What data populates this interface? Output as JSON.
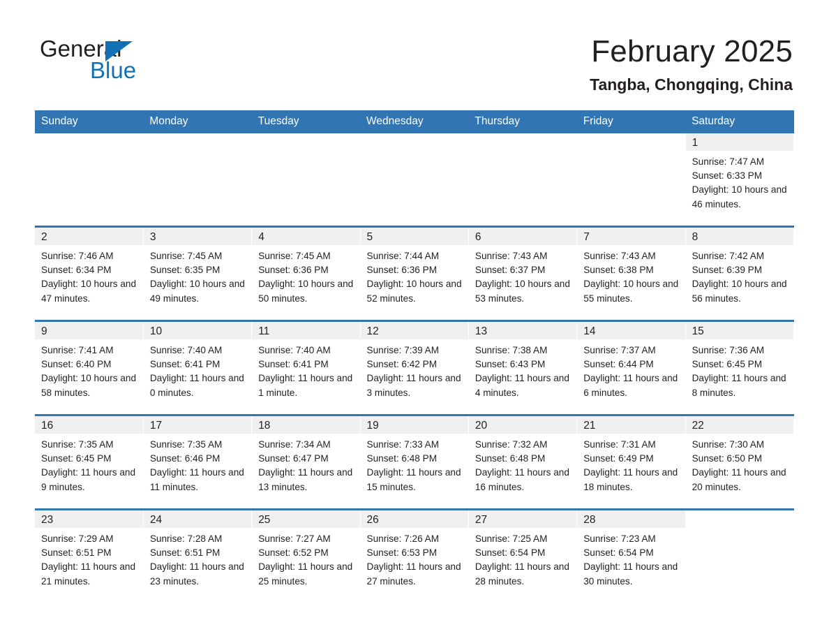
{
  "brand": {
    "name_part1": "General",
    "name_part2": "Blue",
    "accent_color": "#1271b5"
  },
  "header": {
    "title": "February 2025",
    "location": "Tangba, Chongqing, China"
  },
  "calendar": {
    "header_bg": "#3275b3",
    "daynum_bg": "#f0f0f0",
    "weekdays": [
      "Sunday",
      "Monday",
      "Tuesday",
      "Wednesday",
      "Thursday",
      "Friday",
      "Saturday"
    ],
    "weeks": [
      [
        {
          "day": ""
        },
        {
          "day": ""
        },
        {
          "day": ""
        },
        {
          "day": ""
        },
        {
          "day": ""
        },
        {
          "day": ""
        },
        {
          "day": "1",
          "sunrise": "Sunrise: 7:47 AM",
          "sunset": "Sunset: 6:33 PM",
          "daylight": "Daylight: 10 hours and 46 minutes."
        }
      ],
      [
        {
          "day": "2",
          "sunrise": "Sunrise: 7:46 AM",
          "sunset": "Sunset: 6:34 PM",
          "daylight": "Daylight: 10 hours and 47 minutes."
        },
        {
          "day": "3",
          "sunrise": "Sunrise: 7:45 AM",
          "sunset": "Sunset: 6:35 PM",
          "daylight": "Daylight: 10 hours and 49 minutes."
        },
        {
          "day": "4",
          "sunrise": "Sunrise: 7:45 AM",
          "sunset": "Sunset: 6:36 PM",
          "daylight": "Daylight: 10 hours and 50 minutes."
        },
        {
          "day": "5",
          "sunrise": "Sunrise: 7:44 AM",
          "sunset": "Sunset: 6:36 PM",
          "daylight": "Daylight: 10 hours and 52 minutes."
        },
        {
          "day": "6",
          "sunrise": "Sunrise: 7:43 AM",
          "sunset": "Sunset: 6:37 PM",
          "daylight": "Daylight: 10 hours and 53 minutes."
        },
        {
          "day": "7",
          "sunrise": "Sunrise: 7:43 AM",
          "sunset": "Sunset: 6:38 PM",
          "daylight": "Daylight: 10 hours and 55 minutes."
        },
        {
          "day": "8",
          "sunrise": "Sunrise: 7:42 AM",
          "sunset": "Sunset: 6:39 PM",
          "daylight": "Daylight: 10 hours and 56 minutes."
        }
      ],
      [
        {
          "day": "9",
          "sunrise": "Sunrise: 7:41 AM",
          "sunset": "Sunset: 6:40 PM",
          "daylight": "Daylight: 10 hours and 58 minutes."
        },
        {
          "day": "10",
          "sunrise": "Sunrise: 7:40 AM",
          "sunset": "Sunset: 6:41 PM",
          "daylight": "Daylight: 11 hours and 0 minutes."
        },
        {
          "day": "11",
          "sunrise": "Sunrise: 7:40 AM",
          "sunset": "Sunset: 6:41 PM",
          "daylight": "Daylight: 11 hours and 1 minute."
        },
        {
          "day": "12",
          "sunrise": "Sunrise: 7:39 AM",
          "sunset": "Sunset: 6:42 PM",
          "daylight": "Daylight: 11 hours and 3 minutes."
        },
        {
          "day": "13",
          "sunrise": "Sunrise: 7:38 AM",
          "sunset": "Sunset: 6:43 PM",
          "daylight": "Daylight: 11 hours and 4 minutes."
        },
        {
          "day": "14",
          "sunrise": "Sunrise: 7:37 AM",
          "sunset": "Sunset: 6:44 PM",
          "daylight": "Daylight: 11 hours and 6 minutes."
        },
        {
          "day": "15",
          "sunrise": "Sunrise: 7:36 AM",
          "sunset": "Sunset: 6:45 PM",
          "daylight": "Daylight: 11 hours and 8 minutes."
        }
      ],
      [
        {
          "day": "16",
          "sunrise": "Sunrise: 7:35 AM",
          "sunset": "Sunset: 6:45 PM",
          "daylight": "Daylight: 11 hours and 9 minutes."
        },
        {
          "day": "17",
          "sunrise": "Sunrise: 7:35 AM",
          "sunset": "Sunset: 6:46 PM",
          "daylight": "Daylight: 11 hours and 11 minutes."
        },
        {
          "day": "18",
          "sunrise": "Sunrise: 7:34 AM",
          "sunset": "Sunset: 6:47 PM",
          "daylight": "Daylight: 11 hours and 13 minutes."
        },
        {
          "day": "19",
          "sunrise": "Sunrise: 7:33 AM",
          "sunset": "Sunset: 6:48 PM",
          "daylight": "Daylight: 11 hours and 15 minutes."
        },
        {
          "day": "20",
          "sunrise": "Sunrise: 7:32 AM",
          "sunset": "Sunset: 6:48 PM",
          "daylight": "Daylight: 11 hours and 16 minutes."
        },
        {
          "day": "21",
          "sunrise": "Sunrise: 7:31 AM",
          "sunset": "Sunset: 6:49 PM",
          "daylight": "Daylight: 11 hours and 18 minutes."
        },
        {
          "day": "22",
          "sunrise": "Sunrise: 7:30 AM",
          "sunset": "Sunset: 6:50 PM",
          "daylight": "Daylight: 11 hours and 20 minutes."
        }
      ],
      [
        {
          "day": "23",
          "sunrise": "Sunrise: 7:29 AM",
          "sunset": "Sunset: 6:51 PM",
          "daylight": "Daylight: 11 hours and 21 minutes."
        },
        {
          "day": "24",
          "sunrise": "Sunrise: 7:28 AM",
          "sunset": "Sunset: 6:51 PM",
          "daylight": "Daylight: 11 hours and 23 minutes."
        },
        {
          "day": "25",
          "sunrise": "Sunrise: 7:27 AM",
          "sunset": "Sunset: 6:52 PM",
          "daylight": "Daylight: 11 hours and 25 minutes."
        },
        {
          "day": "26",
          "sunrise": "Sunrise: 7:26 AM",
          "sunset": "Sunset: 6:53 PM",
          "daylight": "Daylight: 11 hours and 27 minutes."
        },
        {
          "day": "27",
          "sunrise": "Sunrise: 7:25 AM",
          "sunset": "Sunset: 6:54 PM",
          "daylight": "Daylight: 11 hours and 28 minutes."
        },
        {
          "day": "28",
          "sunrise": "Sunrise: 7:23 AM",
          "sunset": "Sunset: 6:54 PM",
          "daylight": "Daylight: 11 hours and 30 minutes."
        },
        {
          "day": ""
        }
      ]
    ]
  }
}
